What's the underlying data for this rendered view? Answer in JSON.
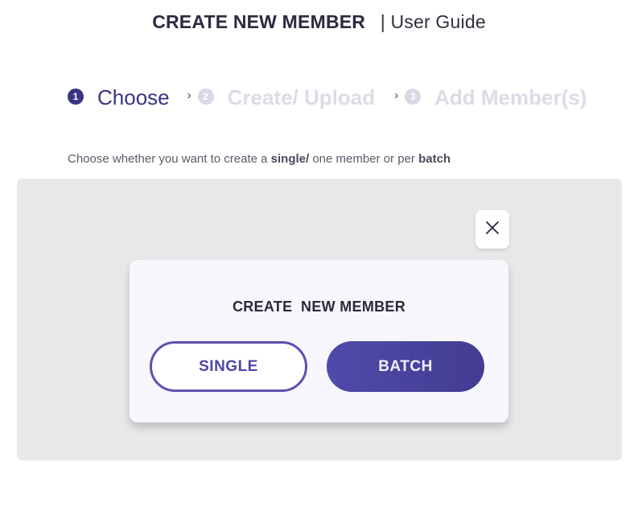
{
  "header": {
    "title": "CREATE NEW MEMBER",
    "separator": "|",
    "subtitle": "User Guide"
  },
  "steps": [
    {
      "number": "1",
      "label": "Choose",
      "state": "active"
    },
    {
      "number": "2",
      "label": "Create/ Upload",
      "state": "inactive"
    },
    {
      "number": "3",
      "label": "Add Member(s)",
      "state": "inactive"
    }
  ],
  "description": {
    "part1": "Choose whether you want to create a ",
    "bold1": "single/",
    "part2": " one member or per ",
    "bold2": "batch"
  },
  "modal": {
    "title": "CREATE  NEW MEMBER",
    "single_label": "SINGLE",
    "batch_label": "BATCH"
  },
  "icons": {
    "close": "close-icon",
    "chevron": "chevron-right-icon"
  },
  "colors": {
    "accent": "#3a3580",
    "overlay": "#e8e8e8",
    "modal_bg": "#f7f6fd",
    "inactive_step": "#dcdbe6"
  }
}
